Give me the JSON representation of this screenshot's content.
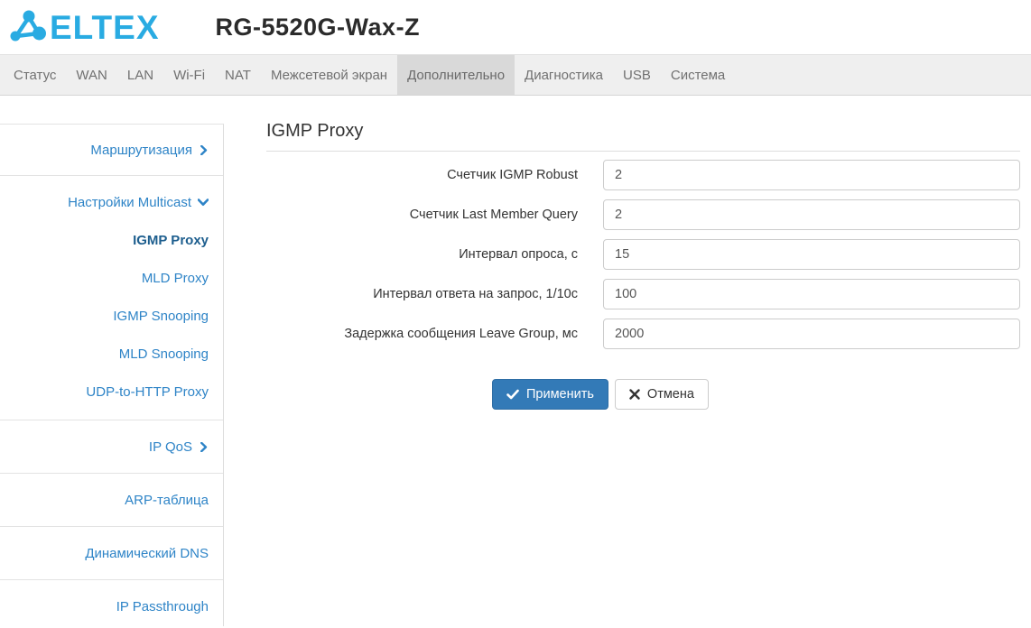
{
  "header": {
    "brand": "ELTEX",
    "title": "RG-5520G-Wax-Z"
  },
  "nav": {
    "tabs": [
      {
        "label": "Статус",
        "active": false
      },
      {
        "label": "WAN",
        "active": false
      },
      {
        "label": "LAN",
        "active": false
      },
      {
        "label": "Wi-Fi",
        "active": false
      },
      {
        "label": "NAT",
        "active": false
      },
      {
        "label": "Межсетевой экран",
        "active": false
      },
      {
        "label": "Дополнительно",
        "active": true
      },
      {
        "label": "Диагностика",
        "active": false
      },
      {
        "label": "USB",
        "active": false
      },
      {
        "label": "Система",
        "active": false
      }
    ]
  },
  "sidebar": {
    "sections": [
      {
        "items": [
          {
            "label": "Маршрутизация",
            "chevron": "right",
            "active": false
          }
        ]
      },
      {
        "items": [
          {
            "label": "Настройки Multicast",
            "chevron": "down",
            "active": false
          },
          {
            "label": "IGMP Proxy",
            "active": true
          },
          {
            "label": "MLD Proxy",
            "active": false
          },
          {
            "label": "IGMP Snooping",
            "active": false
          },
          {
            "label": "MLD Snooping",
            "active": false
          },
          {
            "label": "UDP-to-HTTP Proxy",
            "active": false
          }
        ]
      },
      {
        "items": [
          {
            "label": "IP QoS",
            "chevron": "right",
            "active": false
          }
        ]
      },
      {
        "items": [
          {
            "label": "ARP-таблица",
            "active": false
          }
        ]
      },
      {
        "items": [
          {
            "label": "Динамический DNS",
            "active": false
          }
        ]
      },
      {
        "items": [
          {
            "label": "IP Passthrough",
            "active": false
          }
        ]
      }
    ]
  },
  "main": {
    "title": "IGMP Proxy",
    "fields": [
      {
        "label": "Счетчик IGMP Robust",
        "value": "2"
      },
      {
        "label": "Счетчик Last Member Query",
        "value": "2"
      },
      {
        "label": "Интервал опроса, с",
        "value": "15"
      },
      {
        "label": "Интервал ответа на запрос, 1/10с",
        "value": "100"
      },
      {
        "label": "Задержка сообщения Leave Group, мс",
        "value": "2000"
      }
    ],
    "buttons": {
      "apply": "Применить",
      "cancel": "Отмена"
    }
  },
  "colors": {
    "brand_blue": "#29abe2",
    "link_blue": "#2e84c7",
    "active_link_blue": "#1d5e8e",
    "apply_button_blue": "#337ab7",
    "nav_bg": "#efefef",
    "active_tab_bg": "#d9d9d9"
  }
}
